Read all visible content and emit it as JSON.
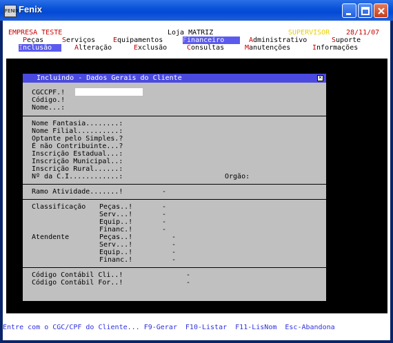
{
  "window": {
    "title": "Fenix",
    "icon_label": "FENIX"
  },
  "header": {
    "company": "EMPRESA TESTE",
    "store": "Loja MATRIZ",
    "user": "SUPERVISOR",
    "date": "28/11/07"
  },
  "menu_row1": {
    "items": [
      {
        "hotkey": "P",
        "rest": "eças"
      },
      {
        "hotkey": "S",
        "rest": "erviços"
      },
      {
        "hotkey": "E",
        "rest": "quipamentos"
      },
      {
        "hotkey": "F",
        "rest": "inanceiro"
      },
      {
        "hotkey": "A",
        "rest": "dministrativo"
      },
      {
        "hotkey": "S",
        "rest": "uporte"
      }
    ]
  },
  "menu_row2": {
    "items": [
      {
        "hotkey": "I",
        "rest": "nclusão"
      },
      {
        "hotkey": "A",
        "rest": "lteração"
      },
      {
        "hotkey": "E",
        "rest": "xclusão"
      },
      {
        "hotkey": "C",
        "rest": "onsultas"
      },
      {
        "hotkey": "M",
        "rest": "anutenções"
      },
      {
        "hotkey": "I",
        "rest": "nformações"
      }
    ]
  },
  "dialog": {
    "title": "Incluindo - Dados Gerais do Cliente",
    "close": "×",
    "fields": {
      "cgccpf": "CGCCPF.!",
      "codigo": "Código.!",
      "nome": "Nome...:",
      "nome_fantasia": "Nome Fantasia........:",
      "nome_filial": "Nome Filial..........:",
      "optante": "Optante pelo Simples.?",
      "nao_contribuinte": "É não Contribuinte...?",
      "inscr_estadual": "Inscrição Estadual...:",
      "inscr_municipal": "Inscrição Municipal..:",
      "inscr_rural": "Inscrição Rural......:",
      "nro_ci": "Nº da C.I............:",
      "orgao": "Orgão:",
      "ramo": "Ramo Atividade.......!",
      "ramo_value": "-",
      "classificacao": "Classificação",
      "atendente": "Atendente",
      "pecas": "Peças..!",
      "serv": "Serv...!",
      "equip": "Equip..!",
      "financ": "Financ.!",
      "dash": "-",
      "cod_cli": "Código Contábil Cli..!",
      "cod_for": "Código Contábil For..!"
    }
  },
  "status_bar": "Entre com o CGC/CPF do Cliente... F9-Gerar  F10-Listar  F11-LisNom  Esc-Abandona"
}
